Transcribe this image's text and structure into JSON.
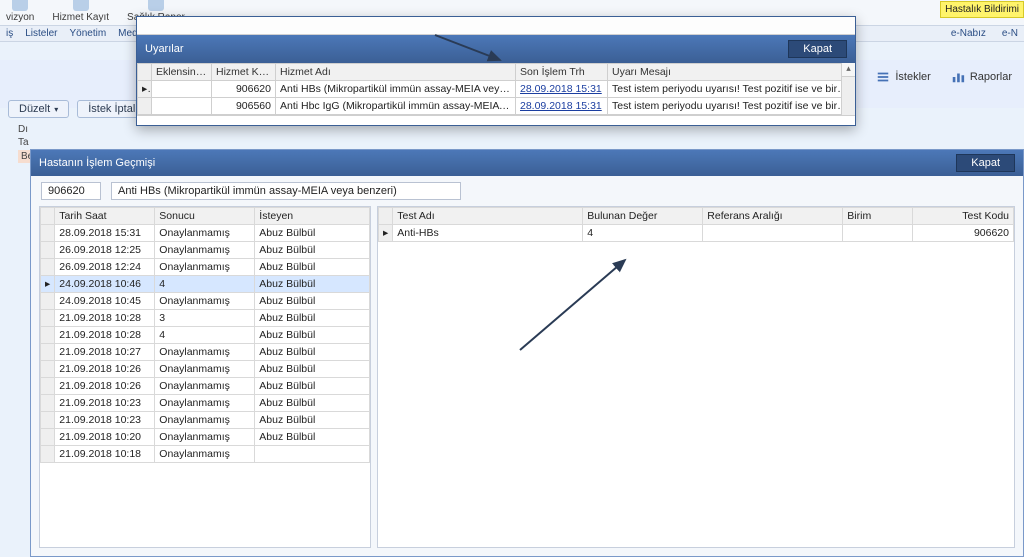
{
  "ribbon": {
    "items": [
      "vizyon",
      "Hizmet Kayıt",
      "Sağlık Rapor"
    ],
    "sub": [
      "iş",
      "Listeler",
      "Yönetim",
      "Medula"
    ],
    "note": "Hastalık Bildirimi",
    "right_links": [
      "e-Nabız",
      "e-N"
    ]
  },
  "toolbar": {
    "duzelt": "Düzelt",
    "istek_iptal": "İstek İptal",
    "istekler": "İstekler",
    "raporlar": "Raporlar"
  },
  "left_stub": {
    "a": "Dı",
    "b": "Ta",
    "c": "Be"
  },
  "uyarilar": {
    "title": "Uyarılar",
    "close": "Kapat",
    "columns": [
      "Eklensin mi?",
      "Hizmet Kodu",
      "Hizmet Adı",
      "Son İşlem Trh",
      "Uyarı Mesajı"
    ],
    "rows": [
      {
        "kod": "906620",
        "ad": "Anti HBs (Mikropartikül immün assay-MEIA veya benzeri",
        "tarih": "28.09.2018 15:31",
        "mesaj": "Test istem periyodu uyarısı! Test pozitif ise ve bir önceki so"
      },
      {
        "kod": "906560",
        "ad": "Anti Hbc IgG (Mikropartikül immün assay-MEIA veya be",
        "tarih": "28.09.2018 15:31",
        "mesaj": "Test istem periyodu uyarısı! Test pozitif ise ve bir önceki so"
      }
    ]
  },
  "panel": {
    "title": "Hastanın İşlem Geçmişi",
    "close": "Kapat",
    "filter_code": "906620",
    "filter_name": "Anti HBs (Mikropartikül immün assay-MEIA veya benzeri)",
    "left_cols": [
      "Tarih Saat",
      "Sonucu",
      "İsteyen"
    ],
    "history": [
      {
        "t": "28.09.2018 15:31",
        "s": "Onaylanmamış",
        "i": "Abuz Bülbül"
      },
      {
        "t": "26.09.2018 12:25",
        "s": "Onaylanmamış",
        "i": "Abuz Bülbül"
      },
      {
        "t": "26.09.2018 12:24",
        "s": "Onaylanmamış",
        "i": "Abuz Bülbül"
      },
      {
        "t": "24.09.2018 10:46",
        "s": "4",
        "i": "Abuz Bülbül",
        "sel": true
      },
      {
        "t": "24.09.2018 10:45",
        "s": "Onaylanmamış",
        "i": "Abuz Bülbül"
      },
      {
        "t": "21.09.2018 10:28",
        "s": "3",
        "i": "Abuz Bülbül"
      },
      {
        "t": "21.09.2018 10:28",
        "s": "4",
        "i": "Abuz Bülbül"
      },
      {
        "t": "21.09.2018 10:27",
        "s": "Onaylanmamış",
        "i": "Abuz Bülbül"
      },
      {
        "t": "21.09.2018 10:26",
        "s": "Onaylanmamış",
        "i": "Abuz Bülbül"
      },
      {
        "t": "21.09.2018 10:26",
        "s": "Onaylanmamış",
        "i": "Abuz Bülbül"
      },
      {
        "t": "21.09.2018 10:23",
        "s": "Onaylanmamış",
        "i": "Abuz Bülbül"
      },
      {
        "t": "21.09.2018 10:23",
        "s": "Onaylanmamış",
        "i": "Abuz Bülbül"
      },
      {
        "t": "21.09.2018 10:20",
        "s": "Onaylanmamış",
        "i": "Abuz Bülbül"
      },
      {
        "t": "21.09.2018 10:18",
        "s": "Onaylanmamış",
        "i": ""
      }
    ],
    "right_cols": [
      "Test Adı",
      "Bulunan Değer",
      "Referans Aralığı",
      "Birim",
      "Test Kodu"
    ],
    "results": [
      {
        "ad": "Anti-HBs",
        "deger": "4",
        "ref": "",
        "birim": "",
        "kod": "906620"
      }
    ]
  }
}
